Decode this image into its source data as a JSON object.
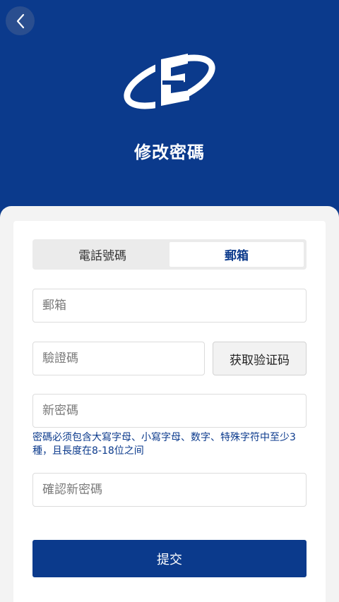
{
  "header": {
    "back_icon": "chevron-left-icon",
    "logo_icon": "company-logo",
    "title": "修改密碼"
  },
  "tabs": [
    {
      "label": "電話號碼",
      "active": false
    },
    {
      "label": "郵箱",
      "active": true
    }
  ],
  "form": {
    "email_placeholder": "郵箱",
    "code_placeholder": "驗證碼",
    "get_code_label": "获取验证码",
    "new_password_placeholder": "新密碼",
    "password_hint": "密碼必须包含大寫字母、小寫字母、数字、特殊字符中至少3種，且長度在8-18位之间",
    "confirm_password_placeholder": "確認新密碼",
    "submit_label": "提交"
  },
  "colors": {
    "brand": "#0b3a8c",
    "background": "#f3f3f3"
  }
}
